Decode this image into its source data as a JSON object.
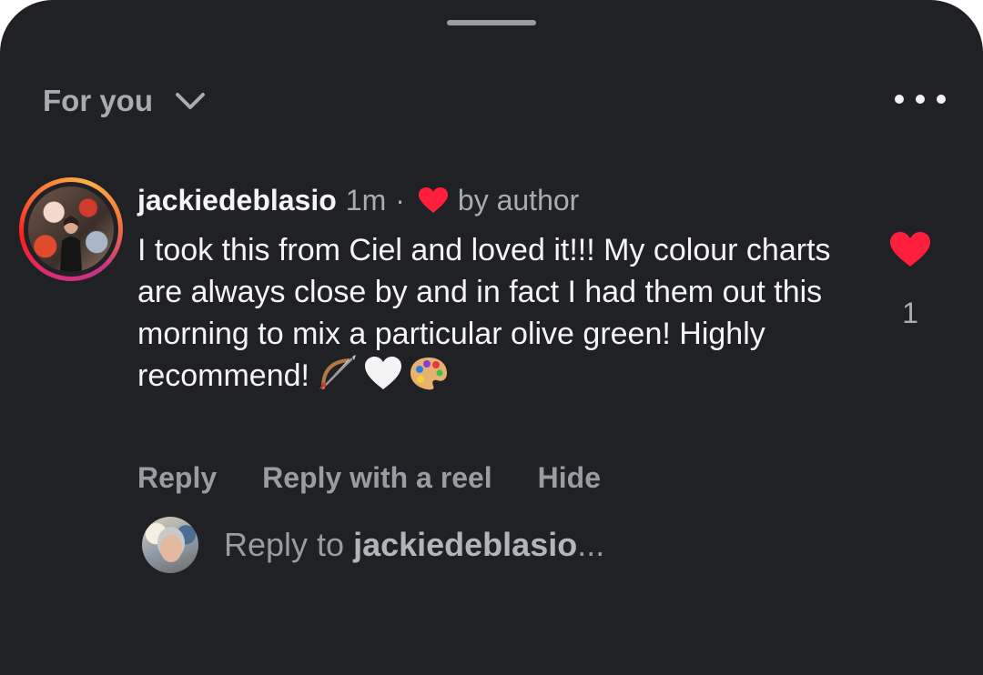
{
  "header": {
    "filter_label": "For you",
    "filter_icon": "chevron-down-icon",
    "more_icon": "more-horizontal-icon"
  },
  "comment": {
    "username": "jackiedeblasio",
    "time": "1m",
    "separator": "·",
    "liked_by_author_icon": "heart-icon",
    "by_author": "by author",
    "text": "I took this from Ciel and loved it!!! My colour charts are always close by and in fact I had them out this morning to mix a particular olive green! Highly recommend!",
    "emojis": [
      "bow-and-arrow-emoji",
      "white-heart-emoji",
      "artist-palette-emoji"
    ],
    "like_count": "1",
    "actions": {
      "reply": "Reply",
      "reply_with_reel": "Reply with a reel",
      "hide": "Hide"
    }
  },
  "reply_box": {
    "prefix": "Reply to ",
    "target": "jackiedeblasio",
    "suffix": "..."
  },
  "colors": {
    "background": "#202124",
    "text_primary": "#f5f5f5",
    "text_secondary": "#a9abb0",
    "heart": "#ff1f3d"
  }
}
